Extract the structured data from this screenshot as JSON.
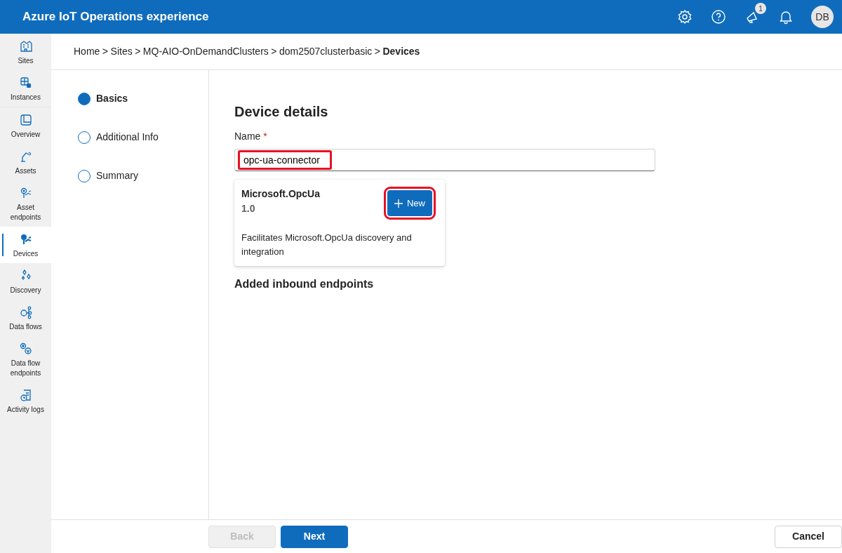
{
  "header": {
    "title": "Azure IoT Operations experience",
    "notification_count": "1",
    "avatar": "DB"
  },
  "sidebar": {
    "groups": [
      [
        {
          "label": "Sites",
          "selected": false
        },
        {
          "label": "Instances",
          "selected": false
        }
      ],
      [
        {
          "label": "Overview",
          "selected": false
        },
        {
          "label": "Assets",
          "selected": false
        },
        {
          "label": "Asset endpoints",
          "selected": false
        },
        {
          "label": "Devices",
          "selected": true
        },
        {
          "label": "Discovery",
          "selected": false
        },
        {
          "label": "Data flows",
          "selected": false
        },
        {
          "label": "Data flow endpoints",
          "selected": false
        },
        {
          "label": "Activity logs",
          "selected": false
        }
      ]
    ]
  },
  "breadcrumb": [
    {
      "label": "Home",
      "current": false
    },
    {
      "label": "Sites",
      "current": false
    },
    {
      "label": "MQ-AIO-OnDemandClusters",
      "current": false
    },
    {
      "label": "dom2507clusterbasic",
      "current": false
    },
    {
      "label": "Devices",
      "current": true
    }
  ],
  "breadcrumb_separator": ">",
  "steps": [
    {
      "label": "Basics",
      "selected": true
    },
    {
      "label": "Additional Info",
      "selected": false
    },
    {
      "label": "Summary",
      "selected": false
    }
  ],
  "form": {
    "title": "Device details",
    "name_label": "Name",
    "required_mark": "*",
    "name_value": "opc-ua-connector",
    "name_highlighted": true,
    "connector": {
      "title": "Microsoft.OpcUa",
      "version": "1.0",
      "button": "New",
      "button_highlighted": true,
      "description": "Facilitates Microsoft.OpcUa discovery and integration"
    },
    "endpoints_heading": "Added inbound endpoints"
  },
  "footer": {
    "back": {
      "label": "Back",
      "disabled": true
    },
    "next": {
      "label": "Next",
      "disabled": false
    },
    "cancel": {
      "label": "Cancel",
      "disabled": false
    }
  }
}
